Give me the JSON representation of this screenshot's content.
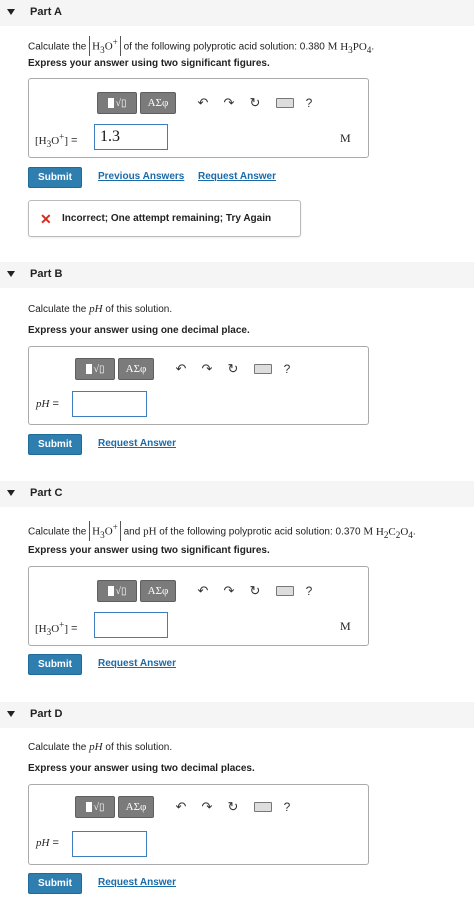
{
  "partA": {
    "title": "Part A",
    "prompt_pre": "Calculate the",
    "prompt_species": "H3O+",
    "prompt_mid": "of the following polyprotic acid solution: 0.380",
    "prompt_unit": "M",
    "prompt_acid": "H3PO4",
    "prompt_end": ".",
    "instruction": "Express your answer using two significant figures.",
    "label": "[H3O+] =",
    "input_value": "1.3",
    "unit": "M",
    "submit": "Submit",
    "link1": "Previous Answers",
    "link2": "Request Answer",
    "feedback": "Incorrect; One attempt remaining; Try Again"
  },
  "partB": {
    "title": "Part B",
    "prompt_pre": "Calculate the",
    "prompt_var": "pH",
    "prompt_end": "of this solution.",
    "instruction": "Express your answer using one decimal place.",
    "label": "pH =",
    "input_value": "",
    "submit": "Submit",
    "link": "Request Answer"
  },
  "partC": {
    "title": "Part C",
    "prompt_pre": "Calculate the",
    "prompt_species": "H3O+",
    "prompt_and": "and",
    "prompt_ph": "pH",
    "prompt_mid": "of the following polyprotic acid solution: 0.370",
    "prompt_unit": "M",
    "prompt_acid": "H2C2O4",
    "prompt_end": ".",
    "instruction": "Express your answer using two significant figures.",
    "label": "[H3O+] =",
    "input_value": "",
    "unit": "M",
    "submit": "Submit",
    "link": "Request Answer"
  },
  "partD": {
    "title": "Part D",
    "prompt_pre": "Calculate the",
    "prompt_var": "pH",
    "prompt_end": "of this solution.",
    "instruction": "Express your answer using two decimal places.",
    "label": "pH =",
    "input_value": "",
    "submit": "Submit",
    "link": "Request Answer"
  },
  "toolbar": {
    "templates_icon": "templates-icon",
    "symbols_label": "ΑΣφ",
    "undo_icon": "undo-icon",
    "redo_icon": "redo-icon",
    "reset_icon": "reset-icon",
    "keyboard_icon": "keyboard-icon",
    "help_label": "?"
  },
  "colors": {
    "submit_bg": "#2e7eb0",
    "link": "#1a6aa8",
    "error_x": "#d52b1e",
    "input_border": "#3f7cc0",
    "toolbar_btn": "#7b7b7b"
  }
}
